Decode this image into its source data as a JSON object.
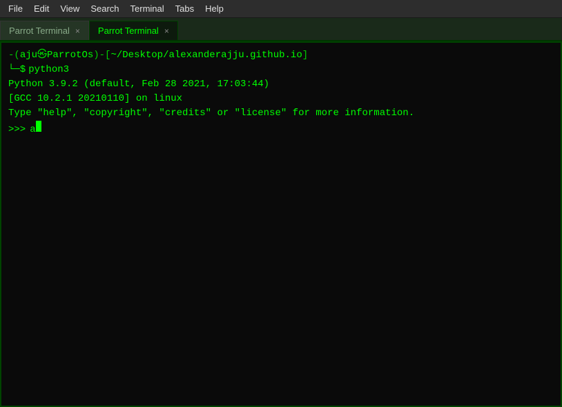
{
  "menubar": {
    "items": [
      "File",
      "Edit",
      "View",
      "Search",
      "Terminal",
      "Tabs",
      "Help"
    ]
  },
  "tabbar": {
    "tab1": {
      "label": "Parrot Terminal",
      "active": false,
      "close": "×"
    },
    "tab2": {
      "label": "Parrot Terminal",
      "active": true,
      "close": "×"
    }
  },
  "terminal": {
    "prompt": {
      "user": "aju",
      "host": "ParrotOs",
      "path": "~/Desktop/alexanderajju.github.io"
    },
    "command": "python3",
    "output_line1": "Python 3.9.2 (default, Feb 28 2021, 17:03:44)",
    "output_line2": "[GCC 10.2.1 20210110] on linux",
    "output_line3": "Type \"help\", \"copyright\", \"credits\" or \"license\" for more information.",
    "repl_prompt": ">>> ",
    "repl_input": "a"
  },
  "colors": {
    "terminal_bg": "#0a0a0a",
    "terminal_fg": "#00ff00",
    "menubar_bg": "#2d2d2d",
    "tabbar_bg": "#1a2a1a"
  }
}
